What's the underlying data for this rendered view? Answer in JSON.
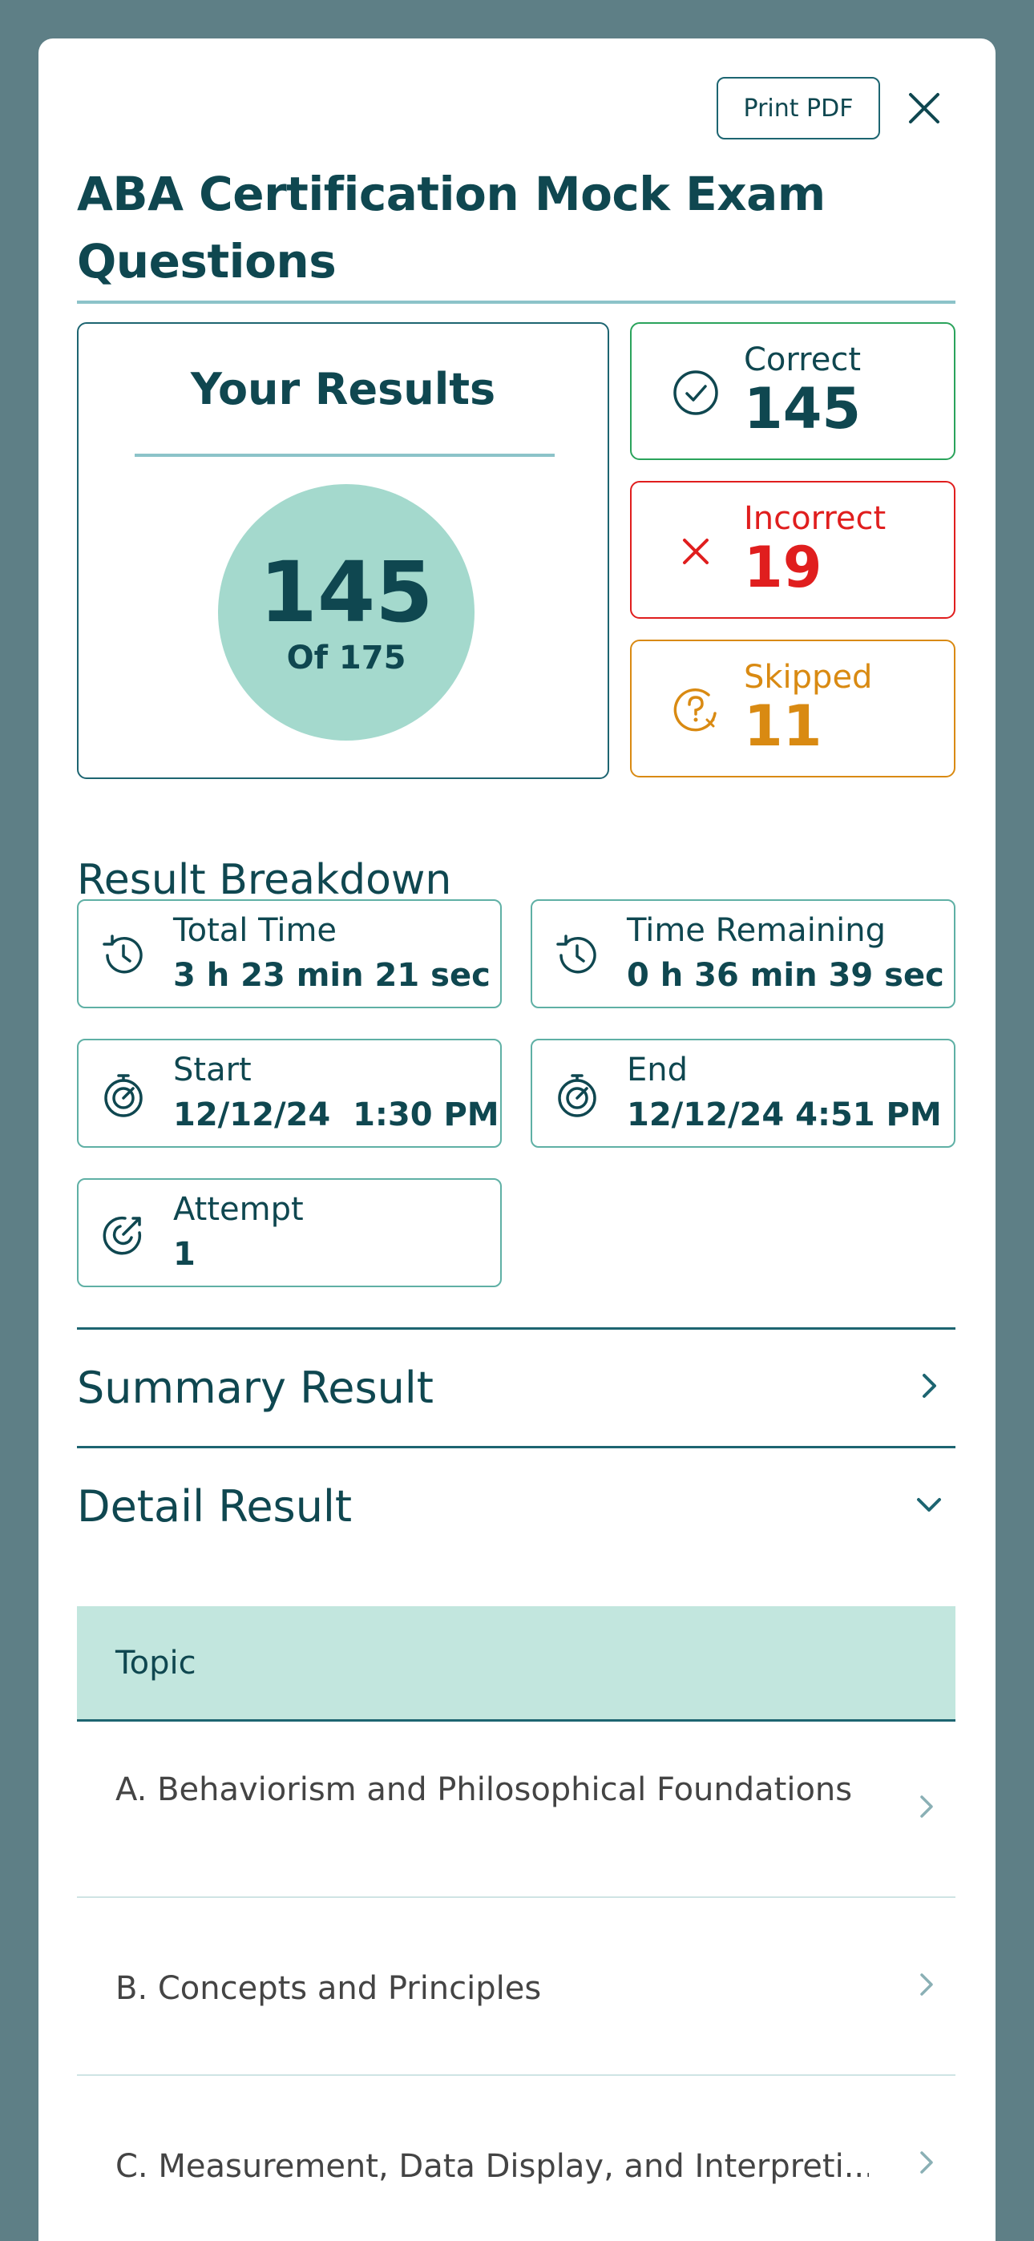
{
  "modal": {
    "print_label": "Print PDF",
    "title": "ABA Certification Mock Exam Questions"
  },
  "results": {
    "heading": "Your Results",
    "score": "145",
    "out_of": "Of 175"
  },
  "stats": {
    "correct": {
      "label": "Correct",
      "value": "145",
      "color": "#2aa35b",
      "icon": "check-circle-icon"
    },
    "incorrect": {
      "label": "Incorrect",
      "value": "19",
      "color": "#e01e1e",
      "icon": "x-icon"
    },
    "skipped": {
      "label": "Skipped",
      "value": "11",
      "color": "#d98a12",
      "icon": "question-circle-icon"
    }
  },
  "breakdown": {
    "title": "Result Breakdown",
    "items": [
      {
        "label": "Total Time",
        "value": "3 h 23 min 21 sec",
        "icon": "history-icon"
      },
      {
        "label": "Time Remaining",
        "value": "0 h 36 min 39 sec",
        "icon": "history-icon"
      },
      {
        "label": "Start",
        "value": "12/12/24  1:30 PM",
        "icon": "stopwatch-icon"
      },
      {
        "label": "End",
        "value": "12/12/24 4:51 PM",
        "icon": "stopwatch-icon"
      },
      {
        "label": "Attempt",
        "value": "1",
        "icon": "target-arrow-icon"
      }
    ]
  },
  "sections": {
    "summary": "Summary Result",
    "detail": "Detail Result"
  },
  "topics": {
    "header": "Topic",
    "rows": [
      "A. Behaviorism and Philosophical Foundations",
      "B. Concepts and Principles",
      "C. Measurement, Data Display, and Interpreti..."
    ]
  }
}
